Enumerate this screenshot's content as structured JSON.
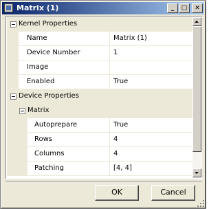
{
  "window": {
    "title": "Matrix (1)",
    "controls": {
      "minimize": "_",
      "maximize": "□",
      "close": "✕"
    }
  },
  "property_grid": {
    "categories": [
      {
        "label": "Kernel Properties",
        "properties": [
          {
            "name": "Name",
            "value": "Matrix (1)"
          },
          {
            "name": "Device Number",
            "value": "1"
          },
          {
            "name": "Image",
            "value": ""
          },
          {
            "name": "Enabled",
            "value": "True"
          }
        ]
      },
      {
        "label": "Device Properties",
        "subcategories": [
          {
            "label": "Matrix",
            "properties": [
              {
                "name": "Autoprepare",
                "value": "True"
              },
              {
                "name": "Rows",
                "value": "4"
              },
              {
                "name": "Columns",
                "value": "4"
              },
              {
                "name": "Patching",
                "value": "[4, 4]"
              }
            ]
          }
        ]
      }
    ]
  },
  "buttons": {
    "ok": "OK",
    "cancel": "Cancel"
  },
  "icons": [
    "app-icon",
    "collapse-icon",
    "scroll-up-icon",
    "scroll-down-icon",
    "resize-grip-icon"
  ]
}
